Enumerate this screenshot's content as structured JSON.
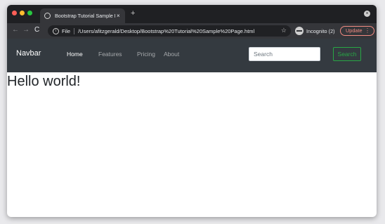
{
  "browser": {
    "tab_title": "Bootstrap Tutorial Sample Page",
    "tab_close": "×",
    "new_tab": "+",
    "window_close": "×",
    "nav": {
      "back": "←",
      "forward": "→",
      "reload": "C"
    },
    "omnibox": {
      "info_glyph": "i",
      "scheme_label": "File",
      "url": "/Users/afitzgerald/Desktop/Bootstrap%20Tutorial%20Sample%20Page.html",
      "star_glyph": "☆"
    },
    "incognito_label": "Incognito (2)",
    "update_label": "Update",
    "menu_glyph": "⋮"
  },
  "navbar": {
    "brand": "Navbar",
    "links": [
      {
        "label": "Home",
        "active": true
      },
      {
        "label": "Features",
        "active": false
      },
      {
        "label": "Pricing",
        "active": false
      },
      {
        "label": "About",
        "active": false
      }
    ],
    "search_placeholder": "Search",
    "search_button": "Search"
  },
  "content": {
    "heading": "Hello world!"
  },
  "colors": {
    "navbar_bg": "#343a40",
    "success": "#28a745",
    "update": "#f28b82"
  }
}
